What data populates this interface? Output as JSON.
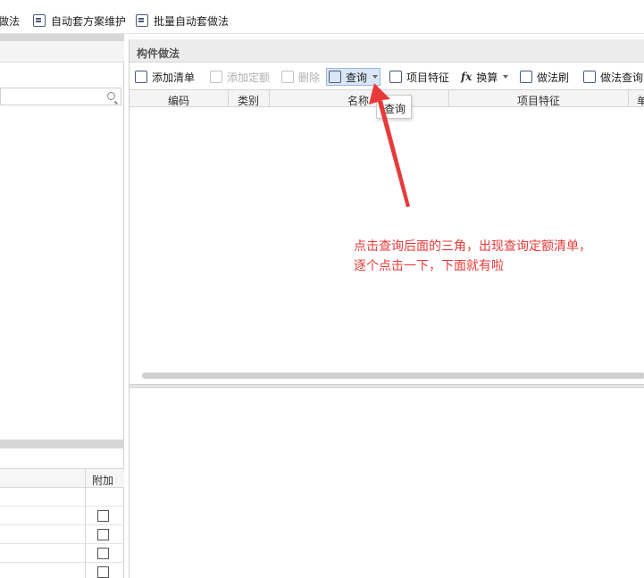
{
  "top_toolbar": {
    "items": [
      {
        "label": "做法",
        "icon": "list-icon"
      },
      {
        "label": "自动套方案维护",
        "icon": "scheme-icon"
      },
      {
        "label": "批量自动套做法",
        "icon": "batch-icon"
      }
    ]
  },
  "left_panel": {
    "table_header": "附加"
  },
  "right_panel": {
    "title": "构件做法",
    "toolbar": {
      "add_list": "添加清单",
      "add_quota": "添加定额",
      "delete": "删除",
      "query": "查询",
      "item_feature": "项目特征",
      "convert": "换算",
      "method_brush": "做法刷",
      "method_query": "做法查询"
    },
    "columns": [
      "编码",
      "类别",
      "名称",
      "项目特征",
      "单"
    ]
  },
  "tooltip": {
    "text": "查询"
  },
  "annotation": {
    "line1": "点击查询后面的三角，出现查询定额清单，",
    "line2": "逐个点击一下，下面就有啦"
  },
  "colors": {
    "annotation": "#e83a3a",
    "active_button": "#d8e6f6"
  }
}
